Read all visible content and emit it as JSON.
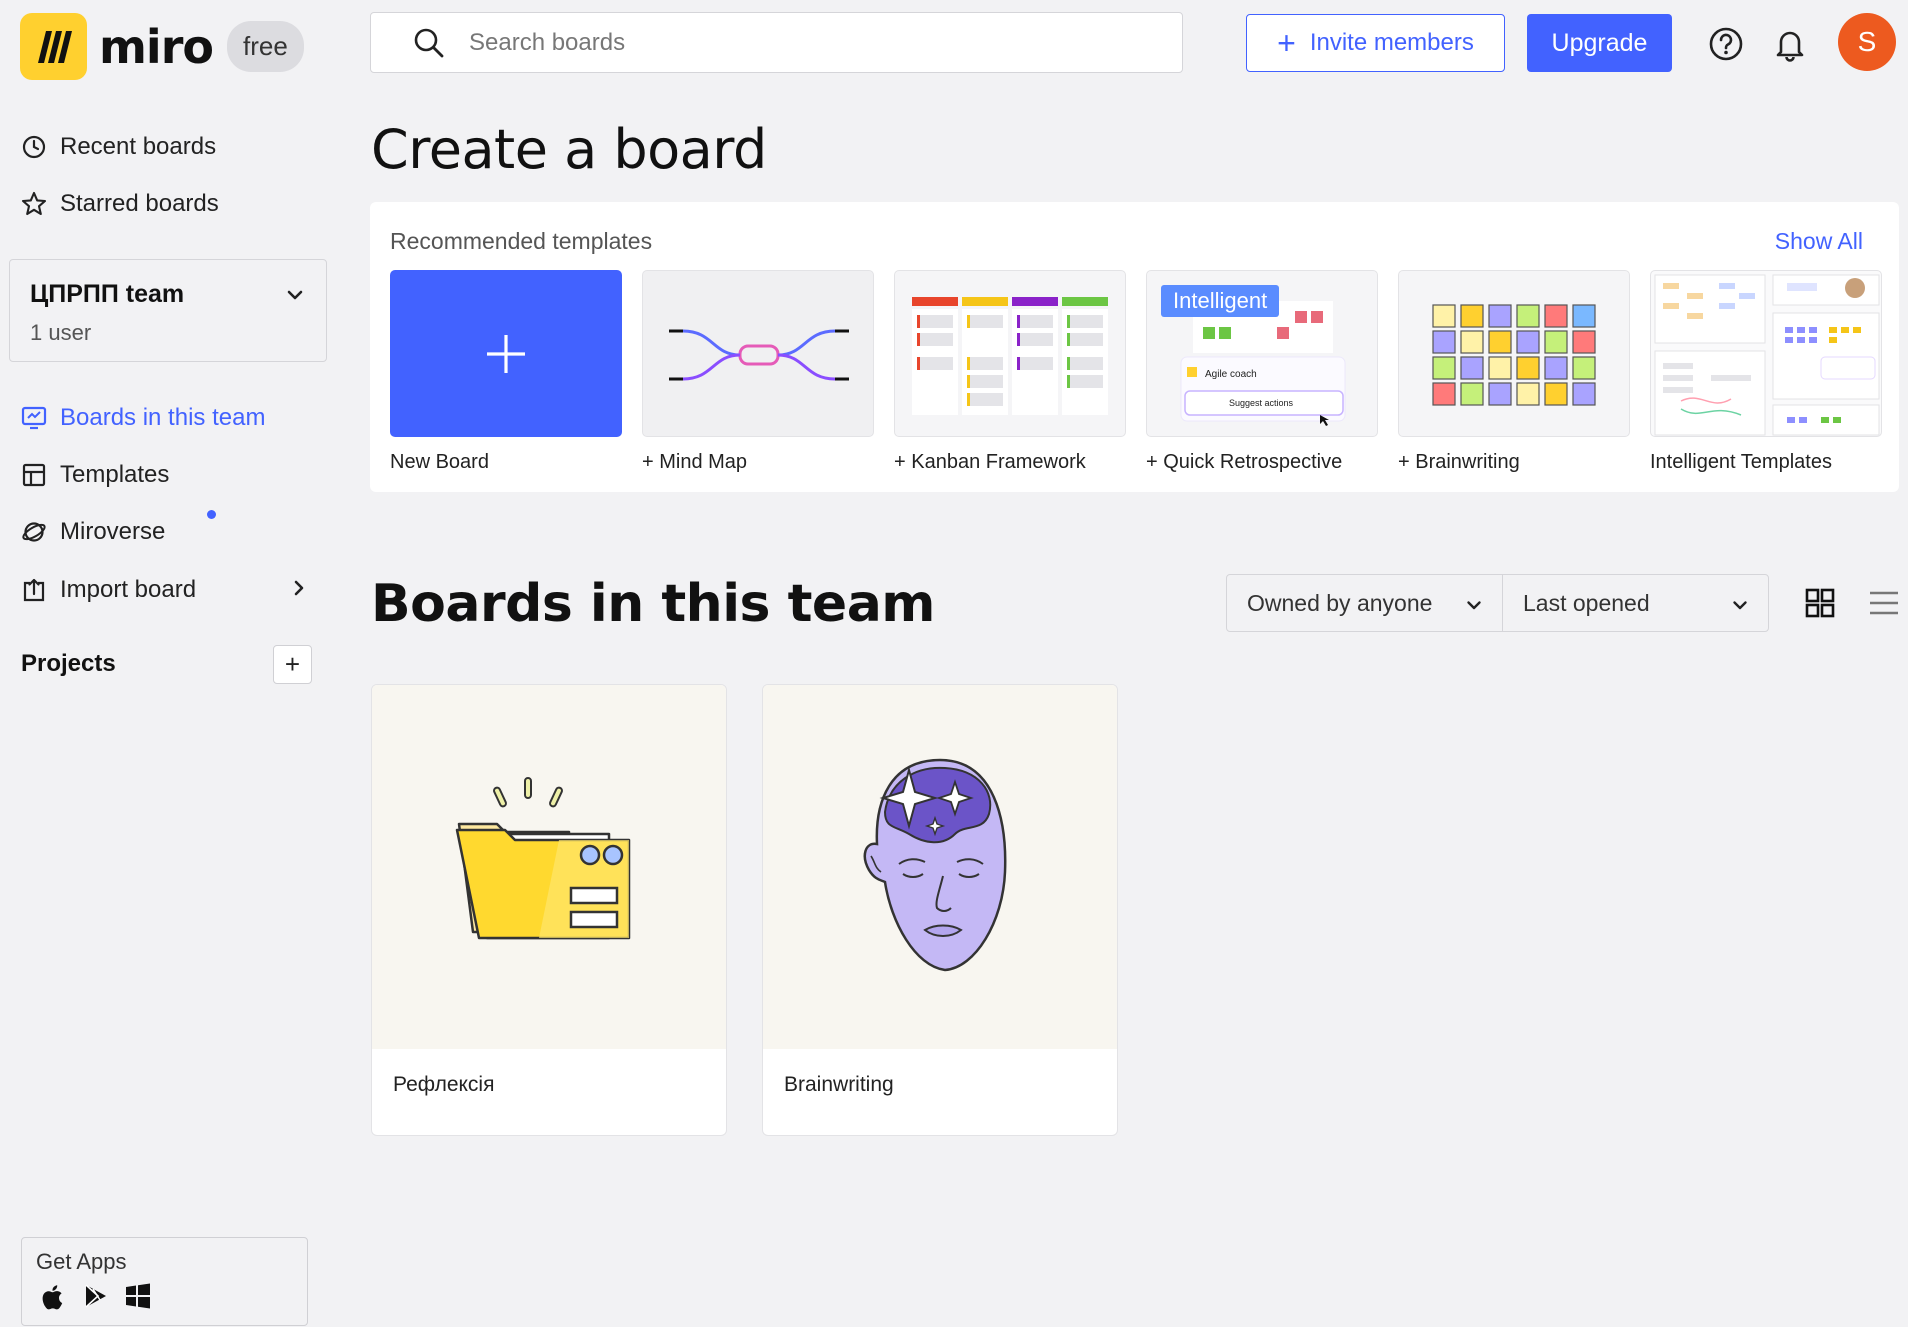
{
  "header": {
    "brand": "miro",
    "plan": "free",
    "search_placeholder": "Search boards",
    "invite_label": "Invite members",
    "upgrade_label": "Upgrade",
    "avatar_initial": "S",
    "accent_color": "#4262ff",
    "avatar_color": "#ed5a1f"
  },
  "sidebar": {
    "top_items": [
      {
        "label": "Recent boards",
        "icon": "clock-icon"
      },
      {
        "label": "Starred boards",
        "icon": "star-icon"
      }
    ],
    "team": {
      "name": "ЦПРПП team",
      "users": "1 user"
    },
    "items": [
      {
        "label": "Boards in this team",
        "icon": "board-icon",
        "active": true
      },
      {
        "label": "Templates",
        "icon": "template-icon"
      },
      {
        "label": "Miroverse",
        "icon": "planet-icon",
        "badge": "new-dot"
      },
      {
        "label": "Import board",
        "icon": "import-icon"
      }
    ],
    "projects_label": "Projects",
    "get_apps_label": "Get Apps",
    "app_icons": [
      "apple-icon",
      "google-play-icon",
      "windows-icon"
    ]
  },
  "create": {
    "title": "Create a board",
    "recommended_label": "Recommended templates",
    "show_all": "Show All",
    "templates": [
      {
        "label": "New Board"
      },
      {
        "label": "+ Mind Map"
      },
      {
        "label": "+ Kanban Framework"
      },
      {
        "label": "+ Quick Retrospective",
        "tag": "Intelligent",
        "preview_lines": [
          "Agile coach",
          "Suggest actions"
        ]
      },
      {
        "label": "+ Brainwriting"
      },
      {
        "label": "Intelligent Templates"
      }
    ]
  },
  "boards": {
    "title": "Boards in this team",
    "owner_filter": "Owned by anyone",
    "sort_filter": "Last opened",
    "items": [
      {
        "title": "Рефлексія",
        "thumb": "folder-illustration"
      },
      {
        "title": "Brainwriting",
        "thumb": "head-illustration"
      }
    ]
  }
}
